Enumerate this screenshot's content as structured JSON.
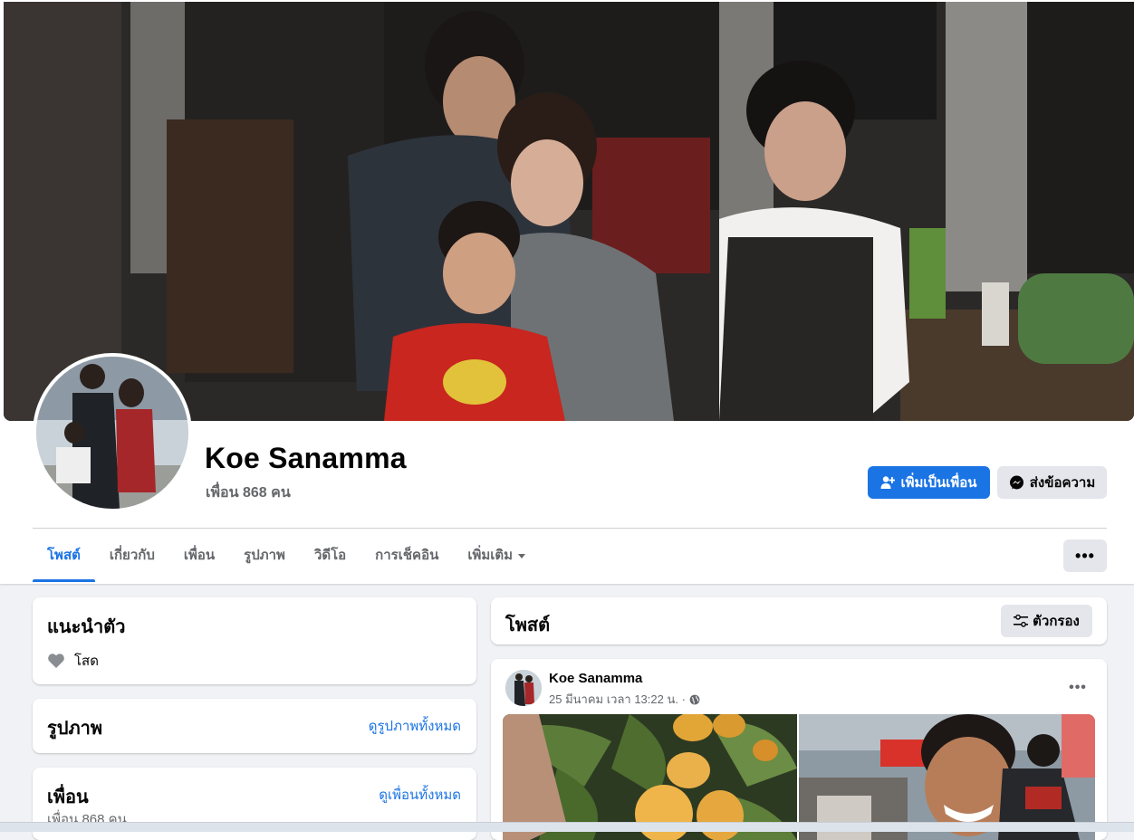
{
  "profile": {
    "name": "Koe Sanamma",
    "friends": "เพื่อน 868 คน"
  },
  "actions": {
    "add_friend": "เพิ่มเป็นเพื่อน",
    "message": "ส่งข้อความ"
  },
  "tabs": [
    {
      "label": "โพสต์",
      "active": true
    },
    {
      "label": "เกี่ยวกับ"
    },
    {
      "label": "เพื่อน"
    },
    {
      "label": "รูปภาพ"
    },
    {
      "label": "วิดีโอ"
    },
    {
      "label": "การเช็คอิน"
    },
    {
      "label": "เพิ่มเติม"
    }
  ],
  "more_button": "•••",
  "intro": {
    "title": "แนะนำตัว",
    "relationship": "โสด"
  },
  "photos_card": {
    "title": "รูปภาพ",
    "link": "ดูรูปภาพทั้งหมด"
  },
  "friends_card": {
    "title": "เพื่อน",
    "link": "ดูเพื่อนทั้งหมด",
    "count": "เพื่อน 868 คน"
  },
  "posts_header": {
    "title": "โพสต์",
    "filter": "ตัวกรอง"
  },
  "post": {
    "author": "Koe Sanamma",
    "time": "25 มีนาคม เวลา 13:22 น. ·",
    "more": "•••"
  },
  "colors": {
    "accent": "#1b74e4",
    "background": "#f0f2f5",
    "secondary_text": "#65676b"
  }
}
